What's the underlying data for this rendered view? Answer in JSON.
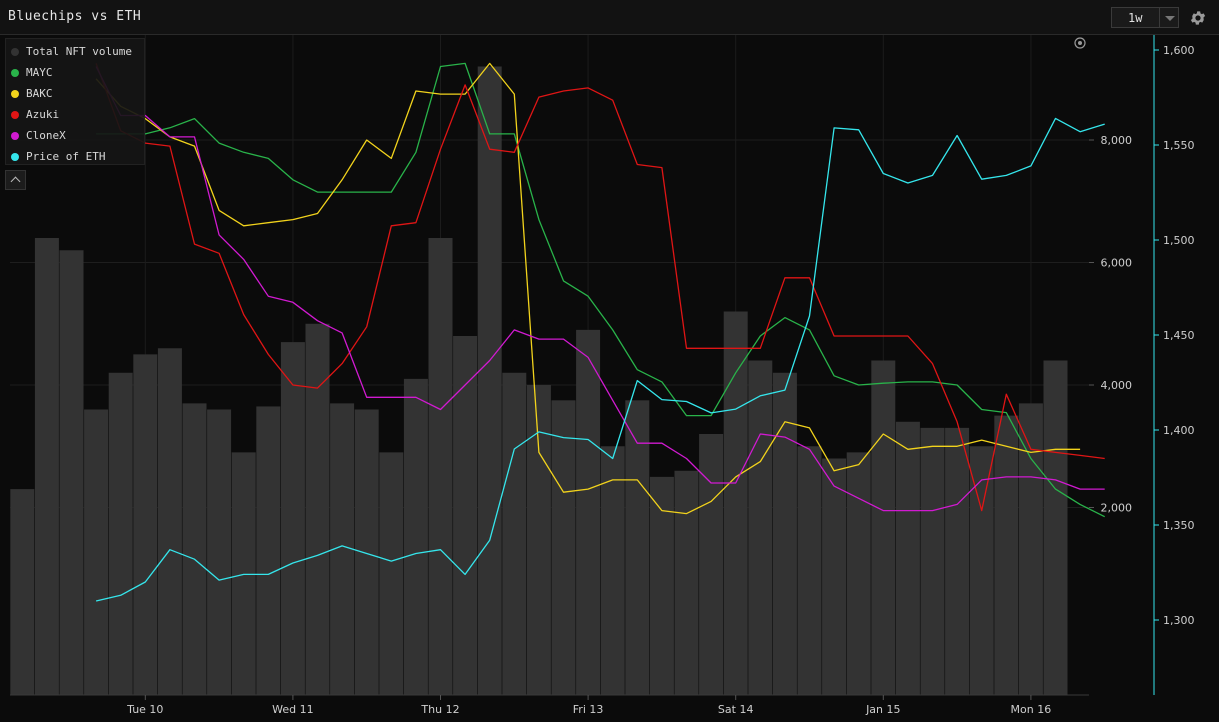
{
  "header": {
    "title": "Bluechips vs ETH",
    "range": "1w",
    "settings_icon": "gear-icon"
  },
  "legend": {
    "items": [
      {
        "label": "Total NFT volume",
        "color": "#333333"
      },
      {
        "label": "MAYC",
        "color": "#29b34a"
      },
      {
        "label": "BAKC",
        "color": "#f2d31c"
      },
      {
        "label": "Azuki",
        "color": "#e01515"
      },
      {
        "label": "CloneX",
        "color": "#d11ad1"
      },
      {
        "label": "Price of ETH",
        "color": "#35e6ec"
      }
    ],
    "collapse_icon": "chevron-up-icon"
  },
  "chart_data": {
    "type": "bar+line",
    "x_tick_labels": [
      "Tue 10",
      "Wed 11",
      "Thu 12",
      "Fri 13",
      "Sat 14",
      "Jan 15",
      "Mon 16"
    ],
    "x_tick_index": [
      5,
      11,
      17,
      23,
      29,
      35,
      41
    ],
    "left_axis": {
      "ticks": [
        2000,
        4000,
        6000,
        8000,
        10000
      ],
      "range": [
        -2000,
        11000
      ]
    },
    "right_axis": {
      "ticks": [
        1300,
        1350,
        1400,
        1450,
        1500,
        1550,
        1600
      ],
      "range": [
        1280,
        1610
      ]
    },
    "bars": {
      "name": "Total NFT volume",
      "values": [
        2300,
        6400,
        6200,
        3600,
        4200,
        4500,
        4600,
        3700,
        3600,
        2900,
        3650,
        4700,
        5000,
        3700,
        3600,
        2900,
        4100,
        6400,
        4800,
        9200,
        4200,
        4000,
        3750,
        4900,
        3000,
        3750,
        2500,
        2600,
        3200,
        5200,
        4400,
        4200,
        3000,
        2800,
        2900,
        4400,
        3400,
        3300,
        3300,
        3000,
        3500,
        3700,
        4400
      ]
    },
    "series": [
      {
        "name": "MAYC",
        "axis": "left",
        "start": 3,
        "values": [
          8100,
          8100,
          8100,
          8200,
          8350,
          7950,
          7800,
          7700,
          7350,
          7150,
          7150,
          7150,
          7150,
          7800,
          9200,
          9250,
          8100,
          8100,
          6700,
          5700,
          5450,
          4900,
          4250,
          4050,
          3500,
          3500,
          4200,
          4800,
          5100,
          4900,
          4150,
          4000,
          4030,
          4050,
          4050,
          4000,
          3600,
          3550,
          2800,
          2300,
          2050,
          1850
        ]
      },
      {
        "name": "BAKC",
        "axis": "left",
        "start": 3,
        "values": [
          9000,
          8550,
          8350,
          8050,
          7900,
          6850,
          6600,
          6650,
          6700,
          6800,
          7350,
          8000,
          7700,
          8800,
          8750,
          8750,
          9250,
          8750,
          2900,
          2250,
          2300,
          2450,
          2450,
          1950,
          1900,
          2100,
          2500,
          2750,
          3400,
          3300,
          2600,
          2700,
          3200,
          2950,
          3000,
          3000,
          3100,
          3000,
          2900,
          2950,
          2950
        ]
      },
      {
        "name": "Azuki",
        "axis": "left",
        "start": 3,
        "values": [
          9250,
          8150,
          7950,
          7900,
          6300,
          6150,
          5150,
          4500,
          4000,
          3950,
          4350,
          4950,
          6600,
          6650,
          7850,
          8900,
          7850,
          7800,
          8700,
          8800,
          8850,
          8650,
          7600,
          7550,
          4600,
          4600,
          4600,
          4600,
          5750,
          5750,
          4800,
          4800,
          4800,
          4800,
          4350,
          3400,
          1950,
          3850,
          2950,
          2900,
          2850,
          2800
        ]
      },
      {
        "name": "CloneX",
        "axis": "left",
        "start": 3,
        "values": [
          9200,
          8400,
          8400,
          8050,
          8050,
          6450,
          6050,
          5450,
          5350,
          5050,
          4850,
          3800,
          3800,
          3800,
          3600,
          4000,
          4400,
          4900,
          4750,
          4750,
          4450,
          3750,
          3050,
          3050,
          2800,
          2400,
          2400,
          3200,
          3150,
          2950,
          2350,
          2150,
          1950,
          1950,
          1950,
          2050,
          2450,
          2500,
          2500,
          2450,
          2300,
          2300
        ]
      },
      {
        "name": "Price of ETH",
        "axis": "right",
        "start": 3,
        "values": [
          1310,
          1313,
          1320,
          1337,
          1332,
          1321,
          1324,
          1324,
          1330,
          1334,
          1339,
          1335,
          1331,
          1335,
          1337,
          1324,
          1342,
          1390,
          1399,
          1396,
          1395,
          1385,
          1426,
          1416,
          1415,
          1409,
          1411,
          1418,
          1421,
          1460,
          1559,
          1558,
          1535,
          1530,
          1534,
          1555,
          1532,
          1534,
          1539,
          1564,
          1557,
          1561
        ]
      }
    ]
  }
}
